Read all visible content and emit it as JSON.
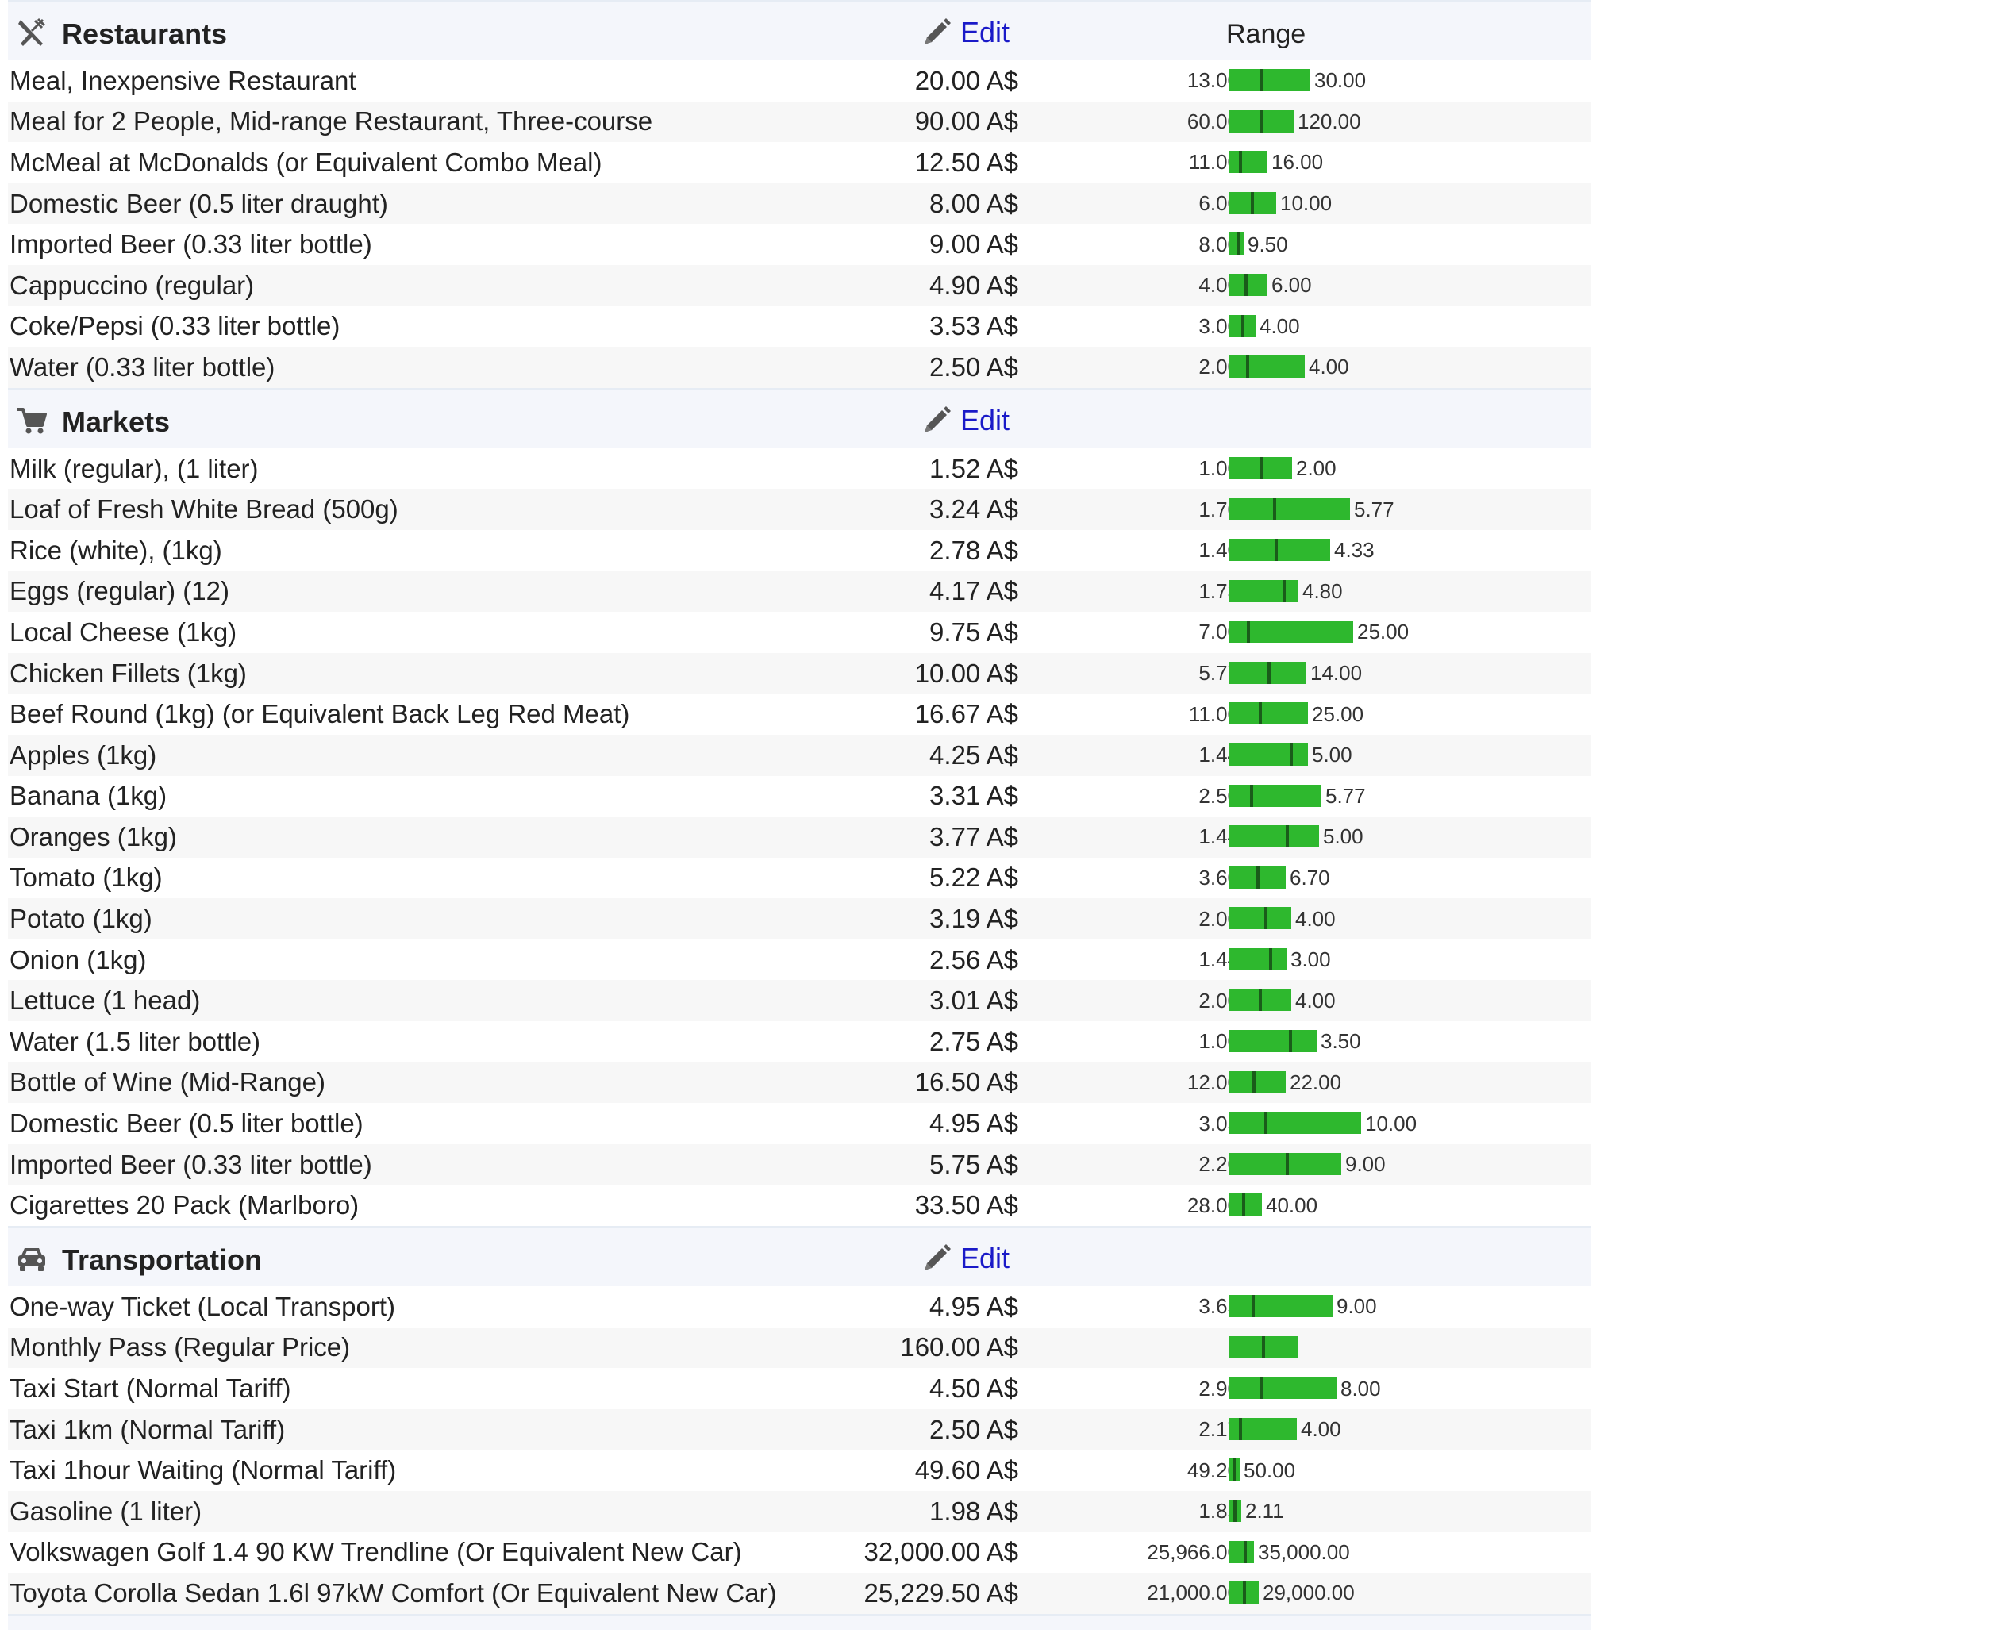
{
  "header": {
    "edit_label": "Edit",
    "range_label": "Range"
  },
  "colors": {
    "bar": "#2eb82e",
    "marker": "#1a5c1a",
    "link": "#1a1ac8",
    "section_bg": "#f4f6fb"
  },
  "sections": [
    {
      "title": "Restaurants",
      "icon": "fork-knife-icon",
      "show_range_header": true,
      "items": [
        {
          "name": "Meal, Inexpensive Restaurant",
          "price": "20.00 A$",
          "min": "13.00",
          "max": "30.00"
        },
        {
          "name": "Meal for 2 People, Mid-range Restaurant, Three-course",
          "price": "90.00 A$",
          "min": "60.00",
          "max": "120.00"
        },
        {
          "name": "McMeal at McDonalds (or Equivalent Combo Meal)",
          "price": "12.50 A$",
          "min": "11.00",
          "max": "16.00"
        },
        {
          "name": "Domestic Beer (0.5 liter draught)",
          "price": "8.00 A$",
          "min": "6.00",
          "max": "10.00"
        },
        {
          "name": "Imported Beer (0.33 liter bottle)",
          "price": "9.00 A$",
          "min": "8.00",
          "max": "9.50"
        },
        {
          "name": "Cappuccino (regular)",
          "price": "4.90 A$",
          "min": "4.00",
          "max": "6.00"
        },
        {
          "name": "Coke/Pepsi (0.33 liter bottle)",
          "price": "3.53 A$",
          "min": "3.00",
          "max": "4.00"
        },
        {
          "name": "Water (0.33 liter bottle)",
          "price": "2.50 A$",
          "min": "2.00",
          "max": "4.00"
        }
      ]
    },
    {
      "title": "Markets",
      "icon": "shopping-cart-icon",
      "show_range_header": false,
      "items": [
        {
          "name": "Milk (regular), (1 liter)",
          "price": "1.52 A$",
          "min": "1.00",
          "max": "2.00"
        },
        {
          "name": "Loaf of Fresh White Bread (500g)",
          "price": "3.24 A$",
          "min": "1.70",
          "max": "5.77"
        },
        {
          "name": "Rice (white), (1kg)",
          "price": "2.78 A$",
          "min": "1.40",
          "max": "4.33"
        },
        {
          "name": "Eggs (regular) (12)",
          "price": "4.17 A$",
          "min": "1.73",
          "max": "4.80"
        },
        {
          "name": "Local Cheese (1kg)",
          "price": "9.75 A$",
          "min": "7.00",
          "max": "25.00"
        },
        {
          "name": "Chicken Fillets (1kg)",
          "price": "10.00 A$",
          "min": "5.77",
          "max": "14.00"
        },
        {
          "name": "Beef Round (1kg) (or Equivalent Back Leg Red Meat)",
          "price": "16.67 A$",
          "min": "11.00",
          "max": "25.00"
        },
        {
          "name": "Apples (1kg)",
          "price": "4.25 A$",
          "min": "1.44",
          "max": "5.00"
        },
        {
          "name": "Banana (1kg)",
          "price": "3.31 A$",
          "min": "2.50",
          "max": "5.77"
        },
        {
          "name": "Oranges (1kg)",
          "price": "3.77 A$",
          "min": "1.44",
          "max": "5.00"
        },
        {
          "name": "Tomato (1kg)",
          "price": "5.22 A$",
          "min": "3.60",
          "max": "6.70"
        },
        {
          "name": "Potato (1kg)",
          "price": "3.19 A$",
          "min": "2.00",
          "max": "4.00"
        },
        {
          "name": "Onion (1kg)",
          "price": "2.56 A$",
          "min": "1.44",
          "max": "3.00"
        },
        {
          "name": "Lettuce (1 head)",
          "price": "3.01 A$",
          "min": "2.00",
          "max": "4.00"
        },
        {
          "name": "Water (1.5 liter bottle)",
          "price": "2.75 A$",
          "min": "1.00",
          "max": "3.50"
        },
        {
          "name": "Bottle of Wine (Mid-Range)",
          "price": "16.50 A$",
          "min": "12.00",
          "max": "22.00"
        },
        {
          "name": "Domestic Beer (0.5 liter bottle)",
          "price": "4.95 A$",
          "min": "3.03",
          "max": "10.00"
        },
        {
          "name": "Imported Beer (0.33 liter bottle)",
          "price": "5.75 A$",
          "min": "2.20",
          "max": "9.00"
        },
        {
          "name": "Cigarettes 20 Pack (Marlboro)",
          "price": "33.50 A$",
          "min": "28.00",
          "max": "40.00"
        }
      ]
    },
    {
      "title": "Transportation",
      "icon": "car-icon",
      "show_range_header": false,
      "items": [
        {
          "name": "One-way Ticket (Local Transport)",
          "price": "4.95 A$",
          "min": "3.65",
          "max": "9.00"
        },
        {
          "name": "Monthly Pass (Regular Price)",
          "price": "160.00 A$",
          "min": "",
          "max": ""
        },
        {
          "name": "Taxi Start (Normal Tariff)",
          "price": "4.50 A$",
          "min": "2.90",
          "max": "8.00"
        },
        {
          "name": "Taxi 1km (Normal Tariff)",
          "price": "2.50 A$",
          "min": "2.17",
          "max": "4.00"
        },
        {
          "name": "Taxi 1hour Waiting (Normal Tariff)",
          "price": "49.60 A$",
          "min": "49.20",
          "max": "50.00"
        },
        {
          "name": "Gasoline (1 liter)",
          "price": "1.98 A$",
          "min": "1.85",
          "max": "2.11"
        },
        {
          "name": "Volkswagen Golf 1.4 90 KW Trendline (Or Equivalent New Car)",
          "price": "32,000.00 A$",
          "min": "25,966.00",
          "max": "35,000.00"
        },
        {
          "name": "Toyota Corolla Sedan 1.6l 97kW Comfort (Or Equivalent New Car)",
          "price": "25,229.50 A$",
          "min": "21,000.00",
          "max": "29,000.00"
        }
      ]
    }
  ]
}
